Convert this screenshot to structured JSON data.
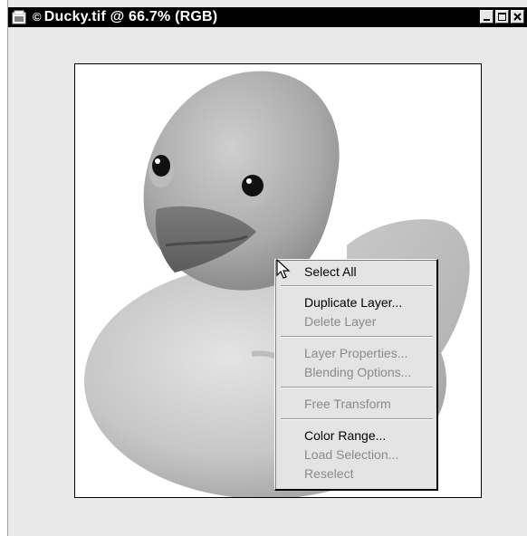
{
  "window": {
    "title": "Ducky.tif @ 66.7% (RGB)",
    "title_mark": "©",
    "buttons": [
      "minimize",
      "maximize",
      "close"
    ]
  },
  "icons": {
    "document": "document-icon",
    "cursor": "arrow-cursor-icon"
  },
  "context_menu": {
    "items": [
      {
        "label": "Select All",
        "enabled": true
      },
      {
        "label": "Duplicate Layer...",
        "enabled": true
      },
      {
        "label": "Delete Layer",
        "enabled": false
      },
      {
        "label": "Layer Properties...",
        "enabled": false
      },
      {
        "label": "Blending Options...",
        "enabled": false
      },
      {
        "label": "Free Transform",
        "enabled": false
      },
      {
        "label": "Color Range...",
        "enabled": true
      },
      {
        "label": "Load Selection...",
        "enabled": false
      },
      {
        "label": "Reselect",
        "enabled": false
      }
    ]
  },
  "colors": {
    "titlebar": "#000000",
    "menu_bg": "#e4e4e4",
    "disabled_text": "#8a8a8a"
  }
}
